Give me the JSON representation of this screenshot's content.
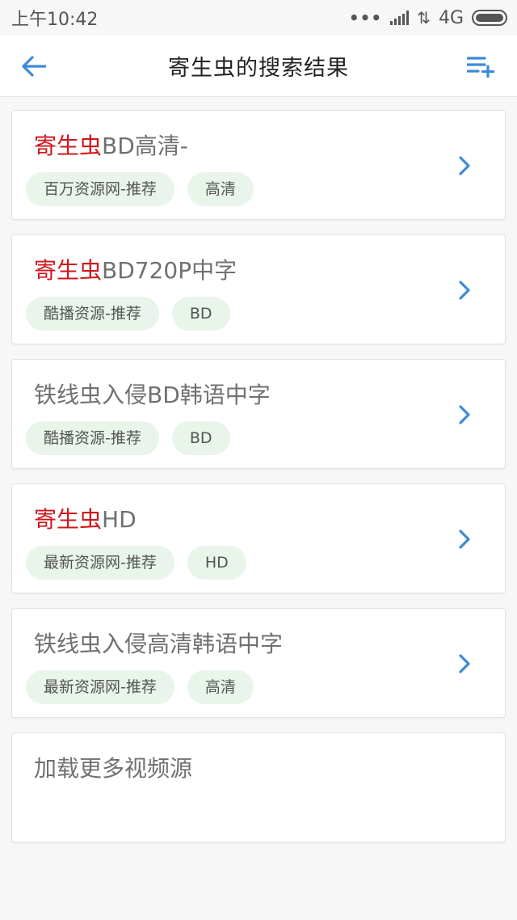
{
  "status_bar": {
    "time": "上午10:42",
    "network": "4G",
    "icons": [
      "more-dots-icon",
      "signal-icon",
      "data-transfer-icon",
      "battery-icon"
    ]
  },
  "header": {
    "title": "寄生虫的搜索结果",
    "back_icon": "arrow-left-icon",
    "playlist_icon": "playlist-add-icon"
  },
  "results": [
    {
      "highlight": "寄生虫",
      "rest": "BD高清-",
      "tags": [
        "百万资源网-推荐",
        "高清"
      ]
    },
    {
      "highlight": "寄生虫",
      "rest": "BD720P中字",
      "tags": [
        "酷播资源-推荐",
        "BD"
      ]
    },
    {
      "highlight": "",
      "rest": "铁线虫入侵BD韩语中字",
      "tags": [
        "酷播资源-推荐",
        "BD"
      ]
    },
    {
      "highlight": "寄生虫",
      "rest": "HD",
      "tags": [
        "最新资源网-推荐",
        "HD"
      ]
    },
    {
      "highlight": "",
      "rest": "铁线虫入侵高清韩语中字",
      "tags": [
        "最新资源网-推荐",
        "高清"
      ]
    }
  ],
  "load_more": {
    "label": "加载更多视频源"
  },
  "colors": {
    "accent": "#3d8bd8",
    "highlight": "#d0171b",
    "tag_bg": "#e9f4ea"
  }
}
